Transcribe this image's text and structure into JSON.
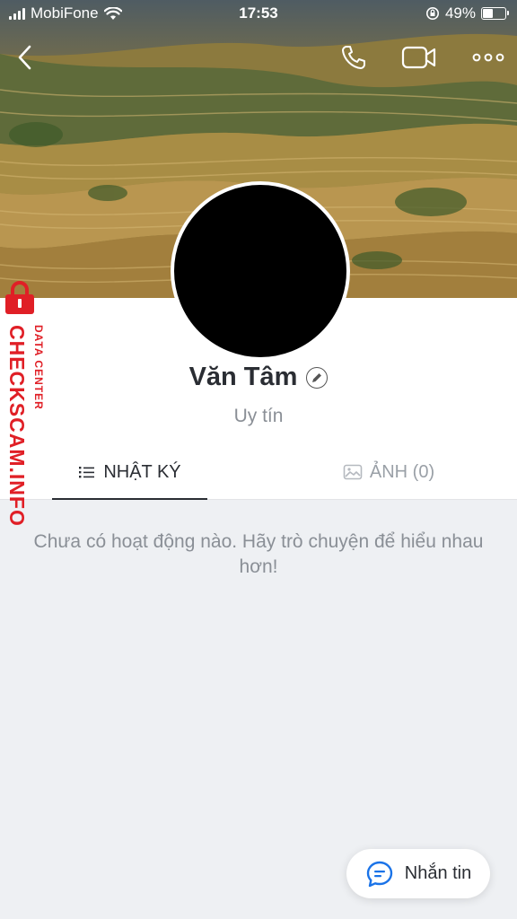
{
  "status_bar": {
    "carrier": "MobiFone",
    "time": "17:53",
    "battery_percent": "49%",
    "battery_level": 0.49
  },
  "top_bar": {
    "icons": [
      "back-arrow-icon",
      "phone-icon",
      "video-call-icon",
      "more-icon"
    ]
  },
  "profile": {
    "name": "Văn Tâm",
    "subtitle": "Uy tín"
  },
  "tabs": [
    {
      "label": "NHẬT KÝ",
      "icon": "list-icon",
      "active": true
    },
    {
      "label": "ẢNH (0)",
      "icon": "image-icon",
      "active": false
    }
  ],
  "empty_state": {
    "message": "Chưa có hoạt động nào. Hãy trò chuyện để hiểu nhau hơn!"
  },
  "watermark": {
    "brand": "CHECKSCAM.INFO",
    "tagline": "DATA CENTER"
  },
  "fab": {
    "label": "Nhắn tin",
    "icon": "chat-bubble-icon"
  },
  "colors": {
    "watermark_red": "#e01f26",
    "chat_blue": "#1a73e8",
    "text_dark": "#2a2d33",
    "text_muted": "#8a8f96",
    "background": "#eef0f3"
  }
}
